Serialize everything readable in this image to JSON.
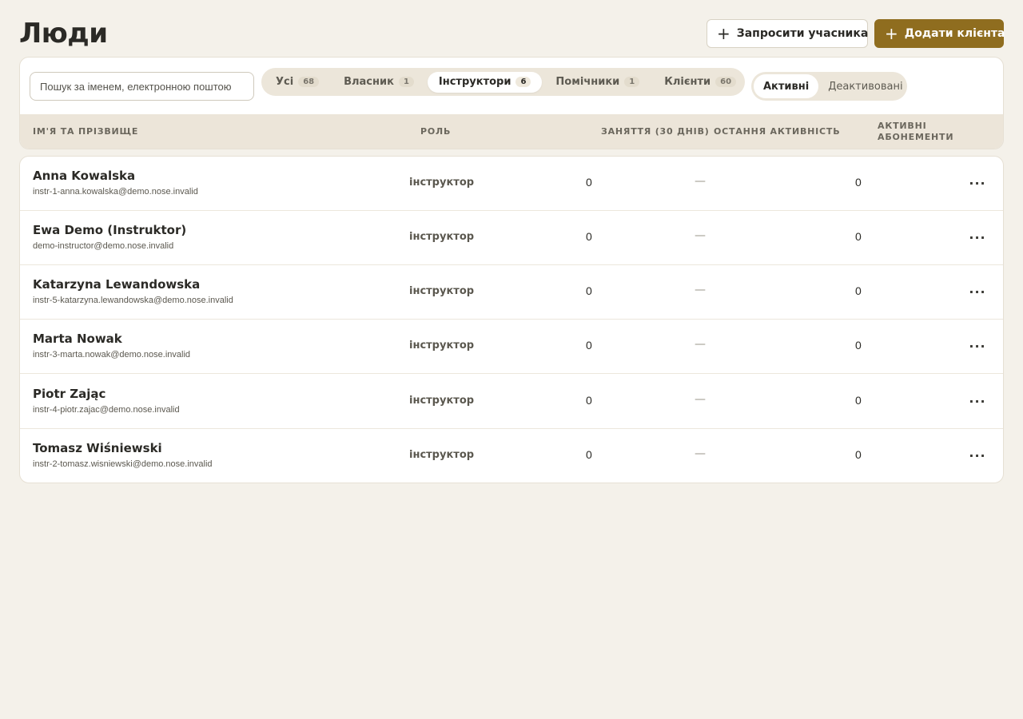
{
  "page": {
    "title": "Люди"
  },
  "header": {
    "invite_label": "Запросити учасника",
    "add_client_label": "Додати клієнта"
  },
  "search": {
    "placeholder": "Пошук за іменем, електронною поштою"
  },
  "role_tabs": [
    {
      "label": "Усі",
      "count": "68",
      "active": false
    },
    {
      "label": "Власник",
      "count": "1",
      "active": false
    },
    {
      "label": "Інструктори",
      "count": "6",
      "active": true
    },
    {
      "label": "Помічники",
      "count": "1",
      "active": false
    },
    {
      "label": "Клієнти",
      "count": "60",
      "active": false
    }
  ],
  "status_toggle": {
    "active_label": "Активні",
    "deactivated_label": "Деактивовані",
    "selected": "active"
  },
  "table": {
    "columns": {
      "name": "Ім'я та прізвище",
      "role": "Роль",
      "sessions": "Заняття (30 днів)",
      "last_activity": "Остання активність",
      "subscriptions": "Активні абонементи"
    },
    "rows": [
      {
        "name": "Anna Kowalska",
        "email": "instr-1-anna.kowalska@demo.nose.invalid",
        "role": "інструктор",
        "sessions": "0",
        "last_activity": "—",
        "subscriptions": "0"
      },
      {
        "name": "Ewa Demo (Instruktor)",
        "email": "demo-instructor@demo.nose.invalid",
        "role": "інструктор",
        "sessions": "0",
        "last_activity": "—",
        "subscriptions": "0"
      },
      {
        "name": "Katarzyna Lewandowska",
        "email": "instr-5-katarzyna.lewandowska@demo.nose.invalid",
        "role": "інструктор",
        "sessions": "0",
        "last_activity": "—",
        "subscriptions": "0"
      },
      {
        "name": "Marta Nowak",
        "email": "instr-3-marta.nowak@demo.nose.invalid",
        "role": "інструктор",
        "sessions": "0",
        "last_activity": "—",
        "subscriptions": "0"
      },
      {
        "name": "Piotr Zając",
        "email": "instr-4-piotr.zajac@demo.nose.invalid",
        "role": "інструктор",
        "sessions": "0",
        "last_activity": "—",
        "subscriptions": "0"
      },
      {
        "name": "Tomasz Wiśniewski",
        "email": "instr-2-tomasz.wisniewski@demo.nose.invalid",
        "role": "інструктор",
        "sessions": "0",
        "last_activity": "—",
        "subscriptions": "0"
      }
    ]
  },
  "icons": {
    "plus": "plus-icon",
    "row_menu": "more-horizontal-icon"
  },
  "colors": {
    "background": "#f4f1ea",
    "primary": "#8f6d1f",
    "table_header": "#ece5d9",
    "pill_bg": "#ece6da"
  }
}
